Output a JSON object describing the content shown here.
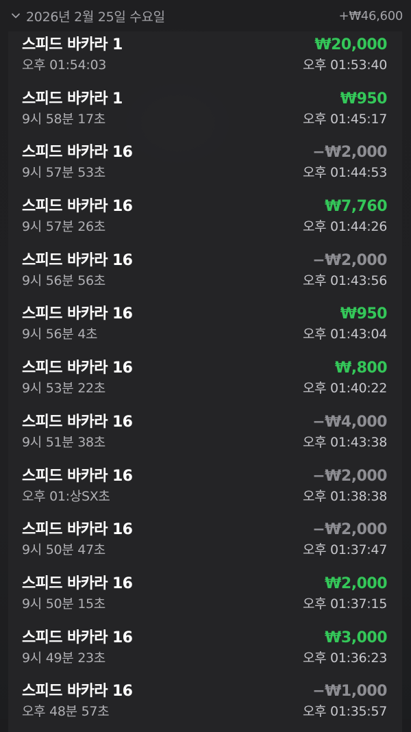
{
  "header": {
    "date": "2026년 2월 25일 수요일",
    "total": "+₩46,600",
    "chevron_icon": "chevron-down-icon"
  },
  "colors": {
    "positive": "#34c759",
    "negative": "#8e8e93"
  },
  "transactions": [
    {
      "title": "스피드 바카라 1",
      "subtitle": "오후 01:54:03",
      "amount": "₩20,000",
      "time": "오후 01:53:40",
      "type": "positive"
    },
    {
      "title": "스피드 바카라 1",
      "subtitle": "9시 58분 17초",
      "amount": "₩950",
      "time": "오후 01:45:17",
      "type": "positive"
    },
    {
      "title": "스피드 바카라 16",
      "subtitle": "9시 57분 53초",
      "amount": "−₩2,000",
      "time": "오후 01:44:53",
      "type": "negative"
    },
    {
      "title": "스피드 바카라 16",
      "subtitle": "9시 57분 26초",
      "amount": "₩7,760",
      "time": "오후 01:44:26",
      "type": "positive"
    },
    {
      "title": "스피드 바카라 16",
      "subtitle": "9시 56분 56초",
      "amount": "−₩2,000",
      "time": "오후 01:43:56",
      "type": "negative"
    },
    {
      "title": "스피드 바카라 16",
      "subtitle": "9시 56분 4초",
      "amount": "₩950",
      "time": "오후 01:43:04",
      "type": "positive"
    },
    {
      "title": "스피드 바카라 16",
      "subtitle": "9시 53분 22초",
      "amount": "₩,800",
      "time": "오후 01:40:22",
      "type": "positive"
    },
    {
      "title": "스피드 바카라 16",
      "subtitle": "9시 51분 38초",
      "amount": "−₩4,000",
      "time": "오후 01:43:38",
      "type": "negative"
    },
    {
      "title": "스피드 바카라 16",
      "subtitle": "오후 01:상SX초",
      "amount": "−₩2,000",
      "time": "오후 01:38:38",
      "type": "negative"
    },
    {
      "title": "스피드 바카라 16",
      "subtitle": "9시 50분 47초",
      "amount": "−₩2,000",
      "time": "오후 01:37:47",
      "type": "negative"
    },
    {
      "title": "스피드 바카라 16",
      "subtitle": "9시 50분 15초",
      "amount": "₩2,000",
      "time": "오후 01:37:15",
      "type": "positive"
    },
    {
      "title": "스피드 바카라 16",
      "subtitle": "9시 49분 23초",
      "amount": "₩3,000",
      "time": "오후 01:36:23",
      "type": "positive"
    },
    {
      "title": "스피드 바카라 16",
      "subtitle": "오후 48분 57초",
      "amount": "−₩1,000",
      "time": "오후 01:35:57",
      "type": "negative"
    }
  ]
}
